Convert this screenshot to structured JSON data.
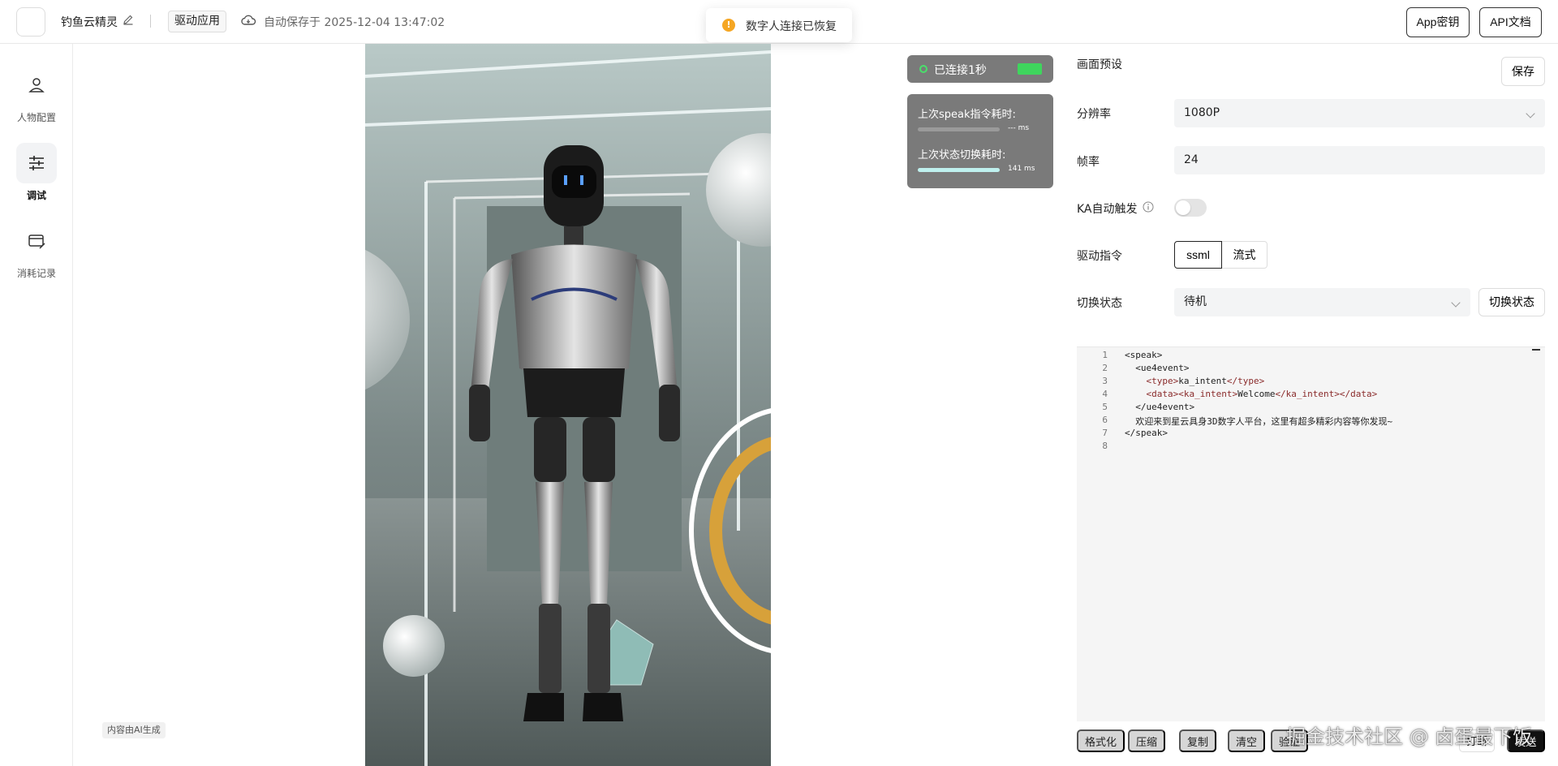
{
  "header": {
    "app_name": "钓鱼云精灵",
    "tag": "驱动应用",
    "autosave": "自动保存于 2025-12-04 13:47:02",
    "toast": "数字人连接已恢复",
    "app_key_btn": "App密钥",
    "api_doc_btn": "API文档"
  },
  "sidebar": {
    "items": [
      {
        "label": "人物配置",
        "icon": "person-icon"
      },
      {
        "label": "调试",
        "icon": "sliders-icon"
      },
      {
        "label": "消耗记录",
        "icon": "card-icon"
      }
    ]
  },
  "preview": {
    "ai_badge": "内容由AI生成"
  },
  "stats": {
    "connected": "已连接1秒",
    "speak_label": "上次speak指令耗时:",
    "speak_value": "--- ms",
    "switch_label": "上次状态切换耗时:",
    "switch_value": "141 ms"
  },
  "settings": {
    "preset_label": "画面预设",
    "save_btn": "保存",
    "resolution_label": "分辨率",
    "resolution_value": "1080P",
    "fps_label": "帧率",
    "fps_value": "24",
    "ka_label": "KA自动触发",
    "ka_enabled": false,
    "drive_label": "驱动指令",
    "drive_options": [
      "ssml",
      "流式"
    ],
    "drive_selected": "ssml",
    "state_label": "切换状态",
    "state_value": "待机",
    "switch_btn": "切换状态"
  },
  "editor": {
    "line_numbers": [
      "1",
      "2",
      "3",
      "4",
      "5",
      "6",
      "7",
      "8"
    ],
    "l1": "<speak>",
    "l2": "  <ue4event>",
    "l3a": "    <type>",
    "l3b": "ka_intent",
    "l3c": "</type>",
    "l4a": "    <data><ka_intent>",
    "l4b": "Welcome",
    "l4c": "</ka_intent></data>",
    "l5": "  </ue4event>",
    "l6": "  欢迎来到星云具身3D数字人平台，这里有超多精彩内容等你发现~",
    "l7": "</speak>",
    "buttons": [
      "格式化",
      "压缩",
      "复制",
      "清空",
      "验证",
      "打断"
    ],
    "send": "发送"
  },
  "watermark": "掘金技术社区 @ 卤蛋最下饭",
  "colors": {
    "accent": "#111111",
    "live_green": "#3fd55d",
    "toast_warning": "#f5a623",
    "switch_bar": "#bff0ee"
  }
}
